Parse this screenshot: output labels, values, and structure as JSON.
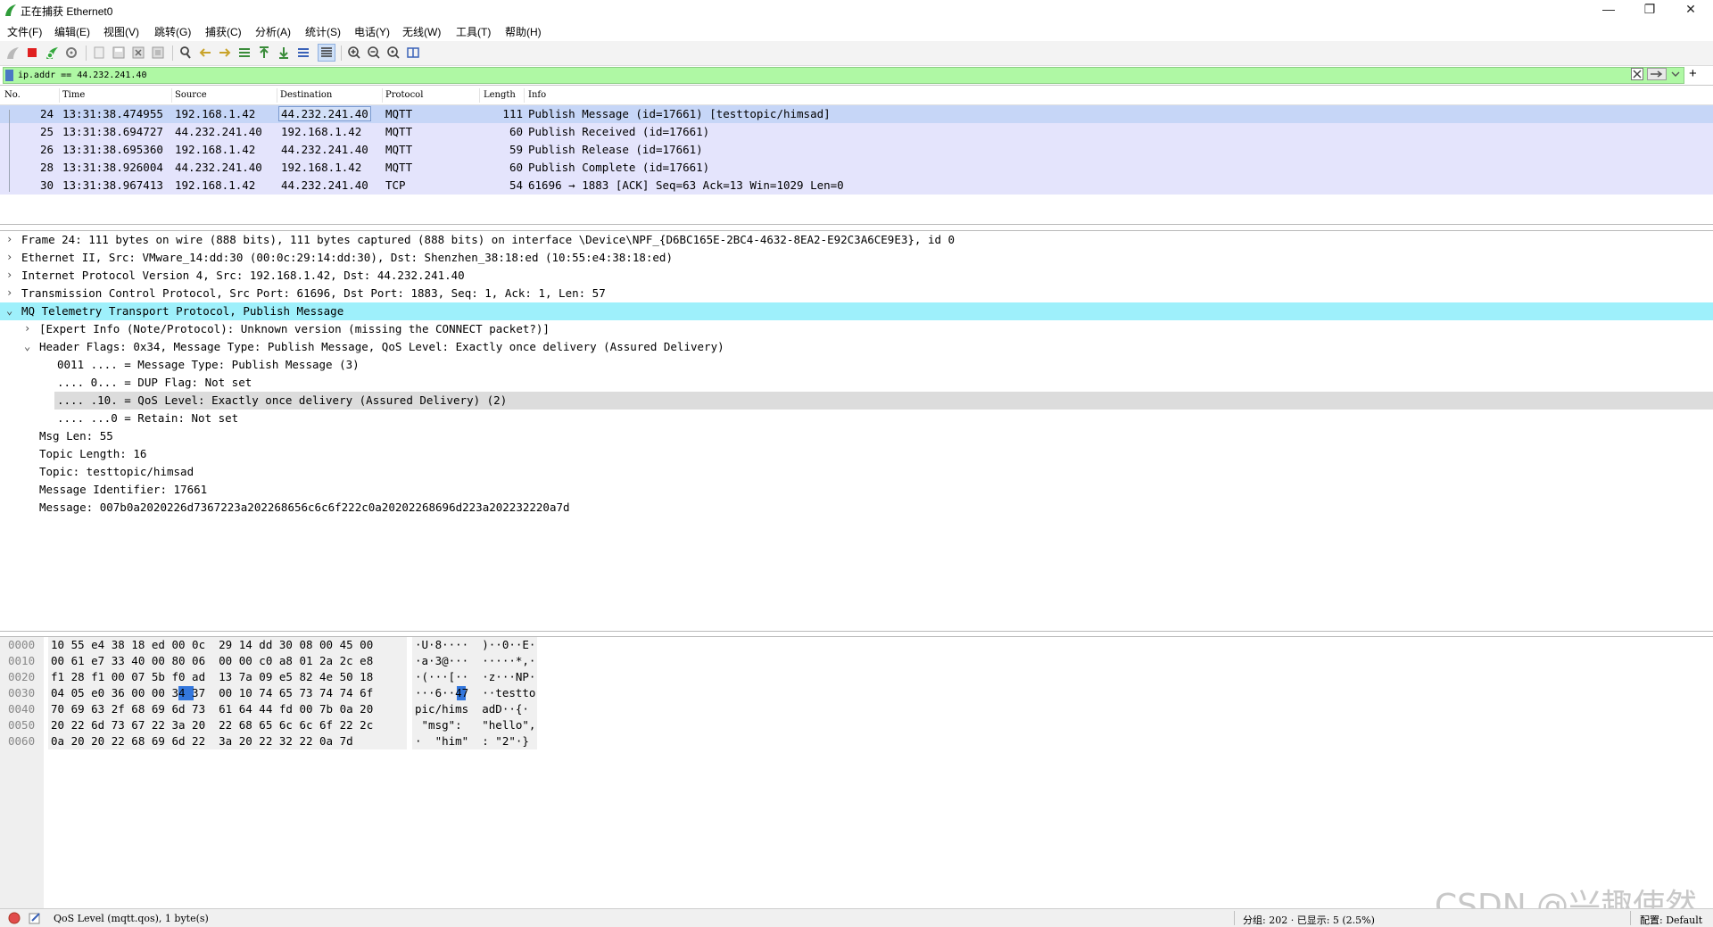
{
  "window": {
    "title": "正在捕获 Ethernet0"
  },
  "menu": [
    "文件(F)",
    "编辑(E)",
    "视图(V)",
    "跳转(G)",
    "捕获(C)",
    "分析(A)",
    "统计(S)",
    "电话(Y)",
    "无线(W)",
    "工具(T)",
    "帮助(H)"
  ],
  "filter": {
    "value": "ip.addr == 44.232.241.40",
    "add_label": "+"
  },
  "packet_list": {
    "columns": [
      "No.",
      "Time",
      "Source",
      "Destination",
      "Protocol",
      "Length",
      "Info"
    ],
    "rows": [
      {
        "no": "24",
        "time": "13:31:38.474955",
        "src": "192.168.1.42",
        "dst": "44.232.241.40",
        "proto": "MQTT",
        "len": "111",
        "info": "Publish Message (id=17661) [testtopic/himsad]"
      },
      {
        "no": "25",
        "time": "13:31:38.694727",
        "src": "44.232.241.40",
        "dst": "192.168.1.42",
        "proto": "MQTT",
        "len": "60",
        "info": "Publish Received (id=17661)"
      },
      {
        "no": "26",
        "time": "13:31:38.695360",
        "src": "192.168.1.42",
        "dst": "44.232.241.40",
        "proto": "MQTT",
        "len": "59",
        "info": "Publish Release (id=17661)"
      },
      {
        "no": "28",
        "time": "13:31:38.926004",
        "src": "44.232.241.40",
        "dst": "192.168.1.42",
        "proto": "MQTT",
        "len": "60",
        "info": "Publish Complete (id=17661)"
      },
      {
        "no": "30",
        "time": "13:31:38.967413",
        "src": "192.168.1.42",
        "dst": "44.232.241.40",
        "proto": "TCP",
        "len": "54",
        "info": "61696 → 1883 [ACK] Seq=63 Ack=13 Win=1029 Len=0"
      }
    ]
  },
  "details": [
    {
      "arrow": "›",
      "text": "Frame 24: 111 bytes on wire (888 bits), 111 bytes captured (888 bits) on interface \\Device\\NPF_{D6BC165E-2BC4-4632-8EA2-E92C3A6CE9E3}, id 0"
    },
    {
      "arrow": "›",
      "text": "Ethernet II, Src: VMware_14:dd:30 (00:0c:29:14:dd:30), Dst: Shenzhen_38:18:ed (10:55:e4:38:18:ed)"
    },
    {
      "arrow": "›",
      "text": "Internet Protocol Version 4, Src: 192.168.1.42, Dst: 44.232.241.40"
    },
    {
      "arrow": "›",
      "text": "Transmission Control Protocol, Src Port: 61696, Dst Port: 1883, Seq: 1, Ack: 1, Len: 57"
    },
    {
      "arrow": "⌄",
      "text": "MQ Telemetry Transport Protocol, Publish Message"
    },
    {
      "arrow": "›",
      "text": "[Expert Info (Note/Protocol): Unknown version (missing the CONNECT packet?)]"
    },
    {
      "arrow": "⌄",
      "text": "Header Flags: 0x34, Message Type: Publish Message, QoS Level: Exactly once delivery (Assured Delivery)"
    },
    {
      "arrow": "",
      "text": "0011 .... = Message Type: Publish Message (3)"
    },
    {
      "arrow": "",
      "text": ".... 0... = DUP Flag: Not set"
    },
    {
      "arrow": "",
      "text": ".... .10. = QoS Level: Exactly once delivery (Assured Delivery) (2)"
    },
    {
      "arrow": "",
      "text": ".... ...0 = Retain: Not set"
    },
    {
      "arrow": "",
      "text": "Msg Len: 55"
    },
    {
      "arrow": "",
      "text": "Topic Length: 16"
    },
    {
      "arrow": "",
      "text": "Topic: testtopic/himsad"
    },
    {
      "arrow": "",
      "text": "Message Identifier: 17661"
    },
    {
      "arrow": "",
      "text": "Message: 007b0a2020226d7367223a202268656c6c6f222c0a20202268696d223a202232220a7d"
    }
  ],
  "bytes": [
    {
      "off": "0000",
      "hex": "10 55 e4 38 18 ed 00 0c  29 14 dd 30 08 00 45 00",
      "ascii": "·U·8····  )··0··E·"
    },
    {
      "off": "0010",
      "hex": "00 61 e7 33 40 00 80 06  00 00 c0 a8 01 2a 2c e8",
      "ascii": "·a·3@···  ·····*,·"
    },
    {
      "off": "0020",
      "hex": "f1 28 f1 00 07 5b f0 ad  13 7a 09 e5 82 4e 50 18",
      "ascii": "·(···[··  ·z···NP·"
    },
    {
      "off": "0030",
      "hex": "04 05 e0 36 00 00 34 37  00 10 74 65 73 74 74 6f",
      "ascii": "···6··47  ··testto"
    },
    {
      "off": "0040",
      "hex": "70 69 63 2f 68 69 6d 73  61 64 44 fd 00 7b 0a 20",
      "ascii": "pic/hims  adD··{· "
    },
    {
      "off": "0050",
      "hex": "20 22 6d 73 67 22 3a 20  22 68 65 6c 6c 6f 22 2c",
      "ascii": " \"msg\":   \"hello\","
    },
    {
      "off": "0060",
      "hex": "0a 20 20 22 68 69 6d 22  3a 20 22 32 22 0a 7d",
      "ascii": "·  \"him\"  : \"2\"·}"
    }
  ],
  "status": {
    "field": "QoS Level (mqtt.qos), 1 byte(s)",
    "packets": "分组: 202 · 已显示: 5 (2.5%)",
    "profile": "配置: Default"
  },
  "watermark": "CSDN @兴趣使然"
}
